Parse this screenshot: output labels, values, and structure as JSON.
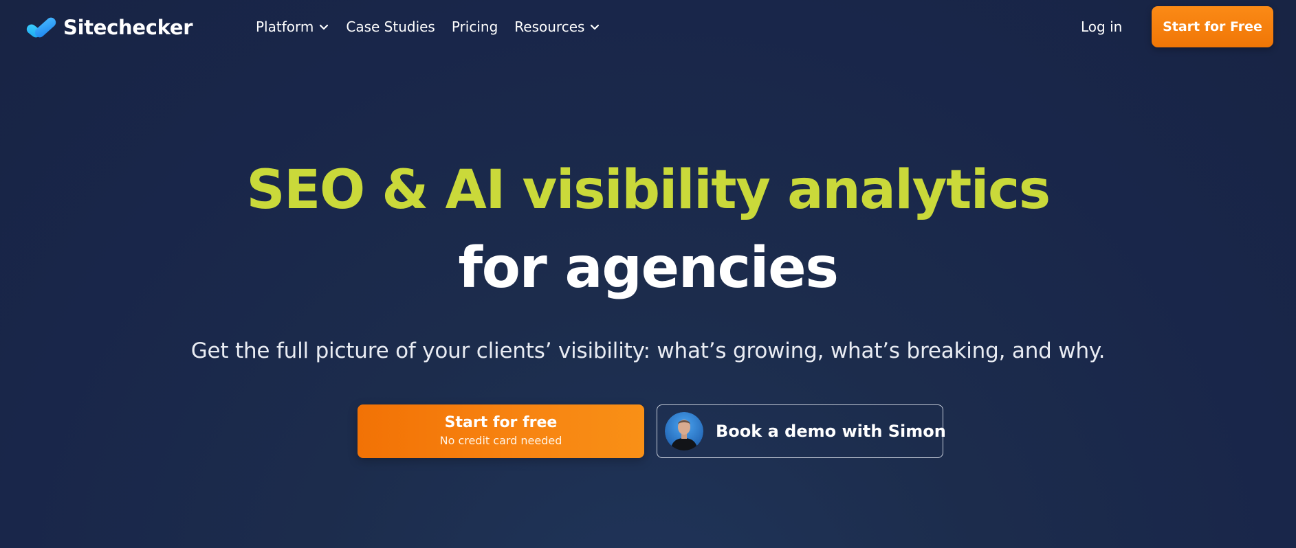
{
  "brand": {
    "name": "Sitechecker",
    "logo_icon": "checkmark-logo-icon",
    "accent_color": "#cad93a",
    "cta_color": "#f7820f",
    "background_color": "#1b2a4a"
  },
  "nav": {
    "items": [
      {
        "label": "Platform",
        "icon": "chevron-down-icon"
      },
      {
        "label": "Case Studies"
      },
      {
        "label": "Pricing"
      },
      {
        "label": "Resources",
        "icon": "chevron-down-icon"
      }
    ],
    "login_label": "Log in",
    "cta_label": "Start for Free"
  },
  "hero": {
    "headline_line1": "SEO & AI visibility analytics",
    "headline_line2": "for agencies",
    "subheadline": "Get the full picture of your clients’ visibility: what’s growing, what’s breaking, and why.",
    "primary_button": {
      "label": "Start for free",
      "sublabel": "No credit card needed"
    },
    "demo_button": {
      "label": "Book a demo with Simon",
      "avatar": "person-avatar"
    }
  }
}
